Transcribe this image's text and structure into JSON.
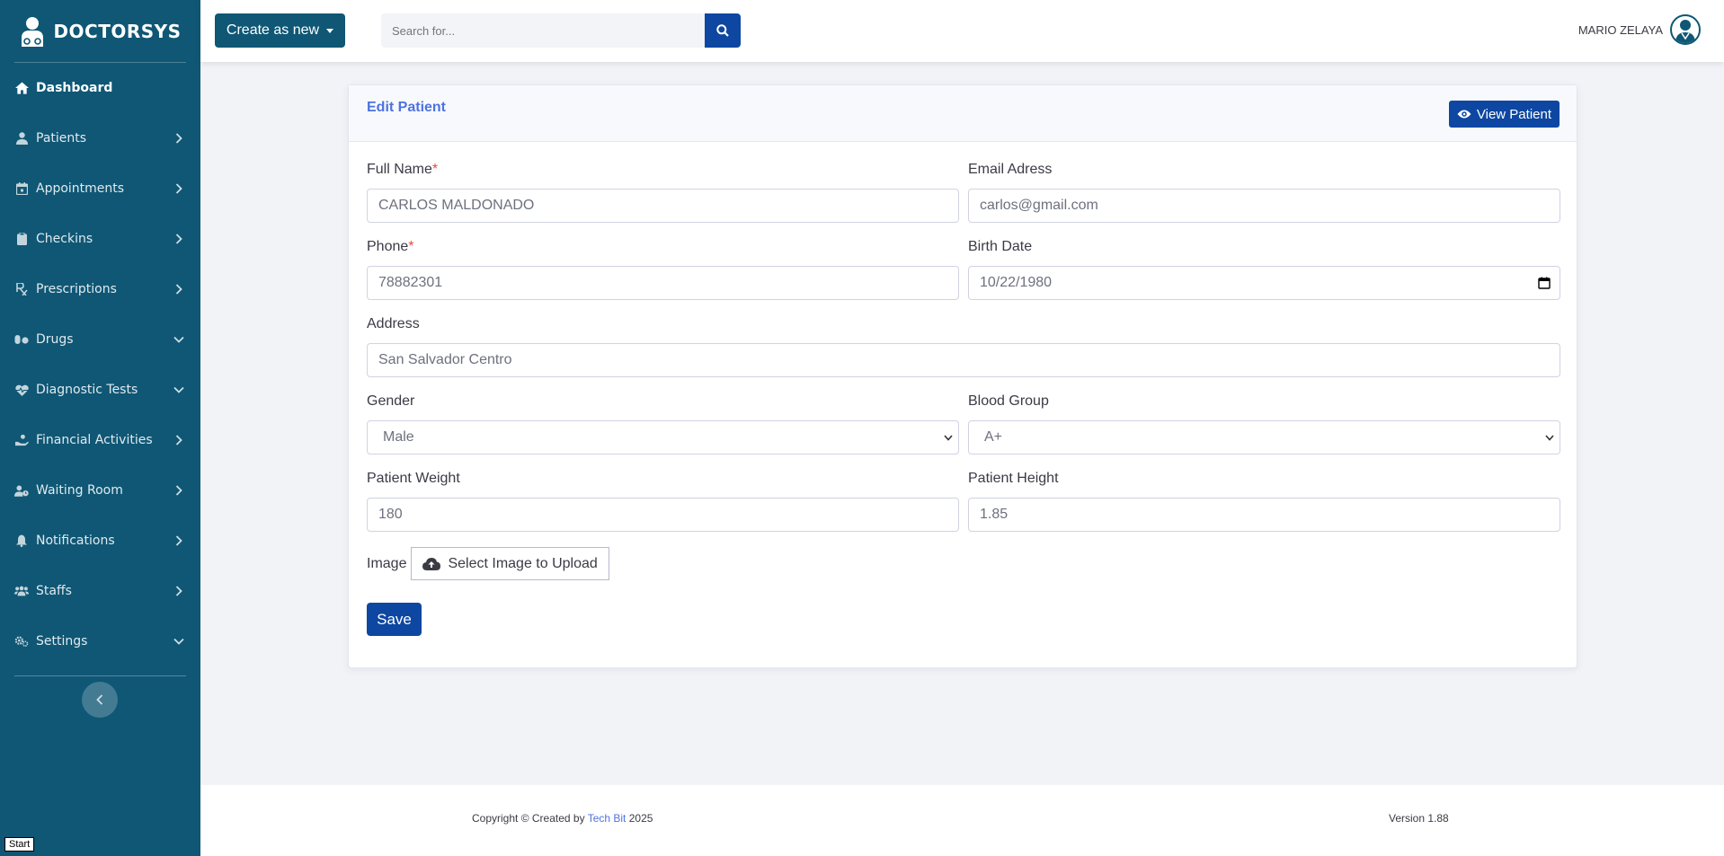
{
  "brand": {
    "name": "DOCTORSYS"
  },
  "sidebar": {
    "items": [
      {
        "label": "Dashboard",
        "icon": "home-icon",
        "chevron": "none"
      },
      {
        "label": "Patients",
        "icon": "user-injured-icon",
        "chevron": "right"
      },
      {
        "label": "Appointments",
        "icon": "calendar-icon",
        "chevron": "right"
      },
      {
        "label": "Checkins",
        "icon": "clipboard-icon",
        "chevron": "right"
      },
      {
        "label": "Prescriptions",
        "icon": "prescription-icon",
        "chevron": "right"
      },
      {
        "label": "Drugs",
        "icon": "pills-icon",
        "chevron": "down"
      },
      {
        "label": "Diagnostic Tests",
        "icon": "heartbeat-icon",
        "chevron": "down"
      },
      {
        "label": "Financial Activities",
        "icon": "hand-holding-icon",
        "chevron": "right"
      },
      {
        "label": "Waiting Room",
        "icon": "user-clock-icon",
        "chevron": "right"
      },
      {
        "label": "Notifications",
        "icon": "bell-icon",
        "chevron": "right"
      },
      {
        "label": "Staffs",
        "icon": "users-icon",
        "chevron": "right"
      },
      {
        "label": "Settings",
        "icon": "cogs-icon",
        "chevron": "down"
      }
    ]
  },
  "topbar": {
    "create_label": "Create as new",
    "search_placeholder": "Search for...",
    "user_name": "MARIO ZELAYA"
  },
  "card": {
    "title": "Edit Patient",
    "view_button": "View Patient"
  },
  "form": {
    "full_name": {
      "label": "Full Name",
      "required_mark": "*",
      "value": "CARLOS MALDONADO"
    },
    "email": {
      "label": "Email Adress",
      "value": "carlos@gmail.com"
    },
    "phone": {
      "label": "Phone",
      "required_mark": "*",
      "value": "78882301"
    },
    "birth_date": {
      "label": "Birth Date",
      "value": "10/22/1980"
    },
    "address": {
      "label": "Address",
      "value": "San Salvador Centro"
    },
    "gender": {
      "label": "Gender",
      "value": "Male"
    },
    "blood_group": {
      "label": "Blood Group",
      "value": "A+"
    },
    "weight": {
      "label": "Patient Weight",
      "value": "180"
    },
    "height": {
      "label": "Patient Height",
      "value": "1.85"
    },
    "image": {
      "label": "Image",
      "button": "Select Image to Upload"
    },
    "save_label": "Save"
  },
  "footer": {
    "copyright_prefix": "Copyright © Created by",
    "company": "Tech Bit",
    "year": "2025",
    "version": "Version 1.88"
  },
  "badge": {
    "start": "Start"
  },
  "colors": {
    "sidebar": "#0f5775",
    "primary_button": "#0d47a1",
    "title_blue": "#4e73df",
    "required": "#e74a3b"
  }
}
